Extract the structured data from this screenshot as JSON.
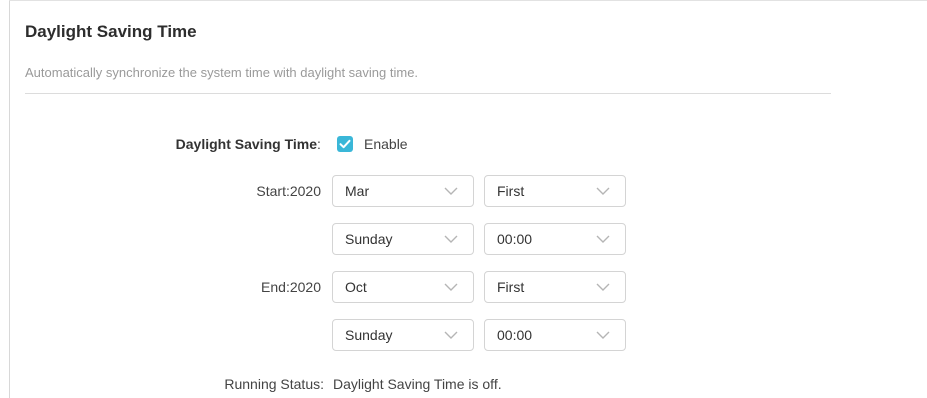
{
  "section": {
    "title": "Daylight Saving Time",
    "description": "Automatically synchronize the system time with daylight saving time."
  },
  "dst": {
    "label": "Daylight Saving Time",
    "colon": ":",
    "enabled": true,
    "enable_text": "Enable"
  },
  "start": {
    "label": "Start:2020",
    "month": "Mar",
    "week": "First",
    "day": "Sunday",
    "time": "00:00"
  },
  "end": {
    "label": "End:2020",
    "month": "Oct",
    "week": "First",
    "day": "Sunday",
    "time": "00:00"
  },
  "running_status": {
    "label": "Running Status:",
    "value": "Daylight Saving Time is off."
  },
  "colors": {
    "accent": "#3ab7d8",
    "border": "#d4d4d4",
    "muted_text": "#9a9a9a"
  }
}
